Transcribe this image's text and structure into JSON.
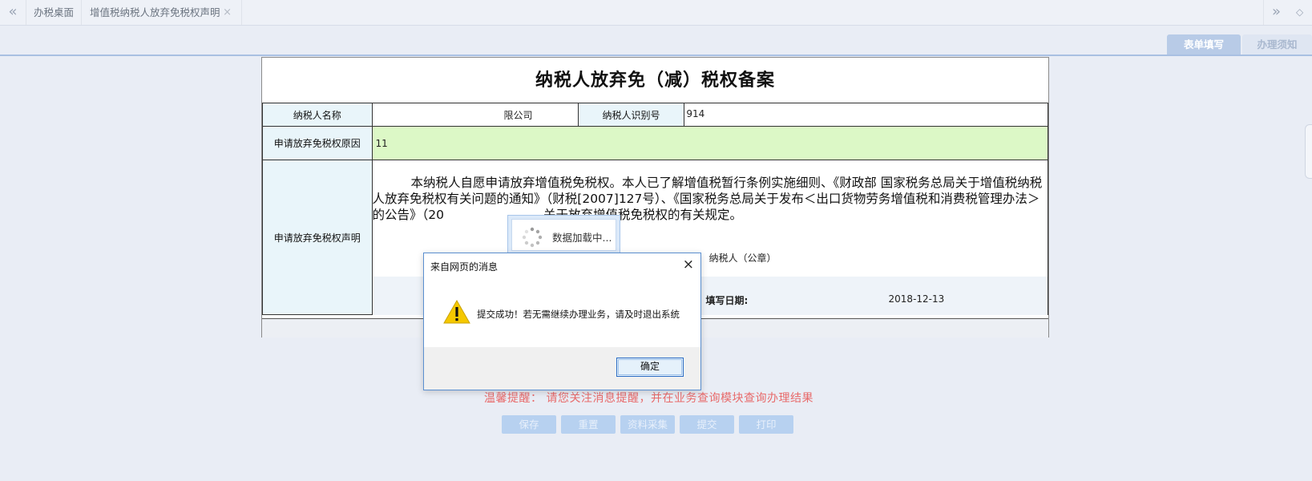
{
  "tabs": {
    "prev_icon": "«",
    "desktop_label": "办税桌面",
    "vat_label": "增值税纳税人放弃免税权声明",
    "close_icon": "×",
    "next_icon": "»",
    "more_icon": "◇"
  },
  "subtabs": {
    "form_label": "表单填写",
    "notice_label": "办理须知"
  },
  "form": {
    "title": "纳税人放弃免（减）税权备案",
    "taxpayer_name_label": "纳税人名称",
    "taxpayer_name_value": "限公司",
    "taxpayer_id_label": "纳税人识别号",
    "taxpayer_id_value": "914",
    "reason_label": "申请放弃免税权原因",
    "reason_value": "11",
    "statement_label": "申请放弃免税权声明",
    "statement_text": "本纳税人自愿申请放弃增值税免税权。本人已了解增值税暂行条例实施细则、《财政部 国家税务总局关于增值税纳税人放弃免税权有关问题的通知》（财税[2007]127号）、《国家税务总局关于发布＜出口货物劳务增值税和消费税管理办法＞的公告》（20　　　　　　　　关于放弃增值税免税权的有关规定。",
    "seal_label": "纳税人（公章）",
    "date_label": "填写日期:",
    "date_value": "2018-12-13"
  },
  "reminder": "温馨提醒：  请您关注消息提醒，并在业务查询模块查询办理结果",
  "buttons": {
    "save": "保存",
    "reset": "重置",
    "collect": "资料采集",
    "submit": "提交",
    "print": "打印"
  },
  "loading": {
    "text": "数据加载中..."
  },
  "dialog": {
    "title": "来自网页的消息",
    "close_icon": "×",
    "message": "提交成功！若无需继续办理业务，请及时退出系统",
    "ok_label": "确定",
    "icon": "warning-icon"
  },
  "colors": {
    "reason_bg": "#dcf8c6",
    "label_bg": "#e9f5fa",
    "reminder": "#e86a6a",
    "button_bg": "#b7d1f0"
  }
}
